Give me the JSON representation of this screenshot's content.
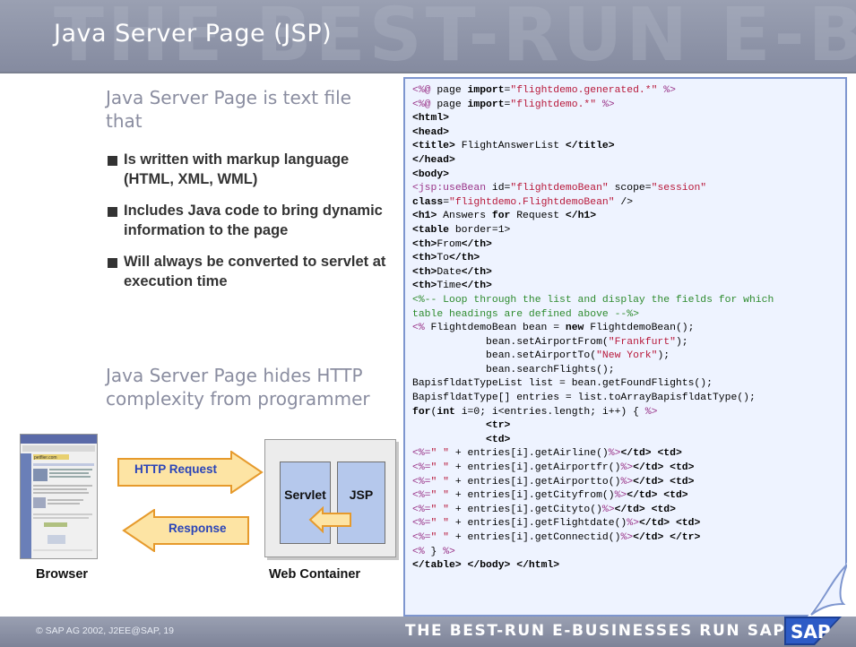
{
  "slide": {
    "title": "Java Server Page (JSP)",
    "header_watermark": "THE BEST-RUN E-BUSINESSES",
    "heading_1": "Java Server Page is text file that",
    "bullets": [
      "Is written with markup language (HTML, XML, WML)",
      "Includes Java code to bring dynamic information to the page",
      "Will always be converted to servlet at execution time"
    ],
    "heading_2": "Java Server Page hides HTTP complexity from programmer"
  },
  "diagram": {
    "browser_caption": "Browser",
    "container_caption": "Web Container",
    "servlet_label": "Servlet",
    "jsp_label": "JSP",
    "request_label": "HTTP Request",
    "response_label": "Response",
    "browser_logo_text": "petflier.com"
  },
  "code": {
    "lines": [
      "<%@ page import=\"flightdemo.generated.*\" %>",
      "<%@ page import=\"flightdemo.*\" %>",
      "<html>",
      "<head>",
      "<title> FlightAnswerList </title>",
      "</head>",
      "<body>",
      "<jsp:useBean id=\"flightdemoBean\" scope=\"session\"",
      "class=\"flightdemo.FlightdemoBean\" />",
      "<h1> Answers for Request </h1>",
      "<table border=1>",
      "<th>From</th>",
      "<th>To</th>",
      "<th>Date</th>",
      "<th>Time</th>",
      "<%-- Loop through the list and display the fields for which",
      "table headings are defined above --%>",
      "<% FlightdemoBean bean = new FlightdemoBean();",
      "            bean.setAirportFrom(\"Frankfurt\");",
      "            bean.setAirportTo(\"New York\");",
      "            bean.searchFlights();",
      "BapisfldatTypeList list = bean.getFoundFlights();",
      "BapisfldatType[] entries = list.toArrayBapisfldatType();",
      "for(int i=0; i<entries.length; i++) { %>",
      "            <tr>",
      "            <td>",
      "<%=\" \" + entries[i].getAirline()%></td> <td>",
      "<%=\" \" + entries[i].getAirportfr()%></td> <td>",
      "<%=\" \" + entries[i].getAirportto()%></td> <td>",
      "<%=\" \" + entries[i].getCityfrom()%></td> <td>",
      "<%=\" \" + entries[i].getCityto()%></td> <td>",
      "<%=\" \" + entries[i].getFlightdate()%></td> <td>",
      "<%=\" \" + entries[i].getConnectid()%></td> </tr>",
      "<% } %>",
      "</table> </body> </html>"
    ]
  },
  "footer": {
    "copyright": "© SAP AG 2002, J2EE@SAP, 19",
    "tagline": "THE BEST-RUN E-BUSINESSES RUN SAP",
    "logo_text": "SAP"
  },
  "colors": {
    "header": "#8c92a6",
    "heading_text": "#8a8da0",
    "code_bg": "#eef3ff",
    "code_border": "#7e96cf",
    "arrow_fill": "#fde4a4",
    "arrow_stroke": "#e69a2c",
    "arrow_text": "#2a44b8",
    "box_fill": "#b5c8ec"
  }
}
